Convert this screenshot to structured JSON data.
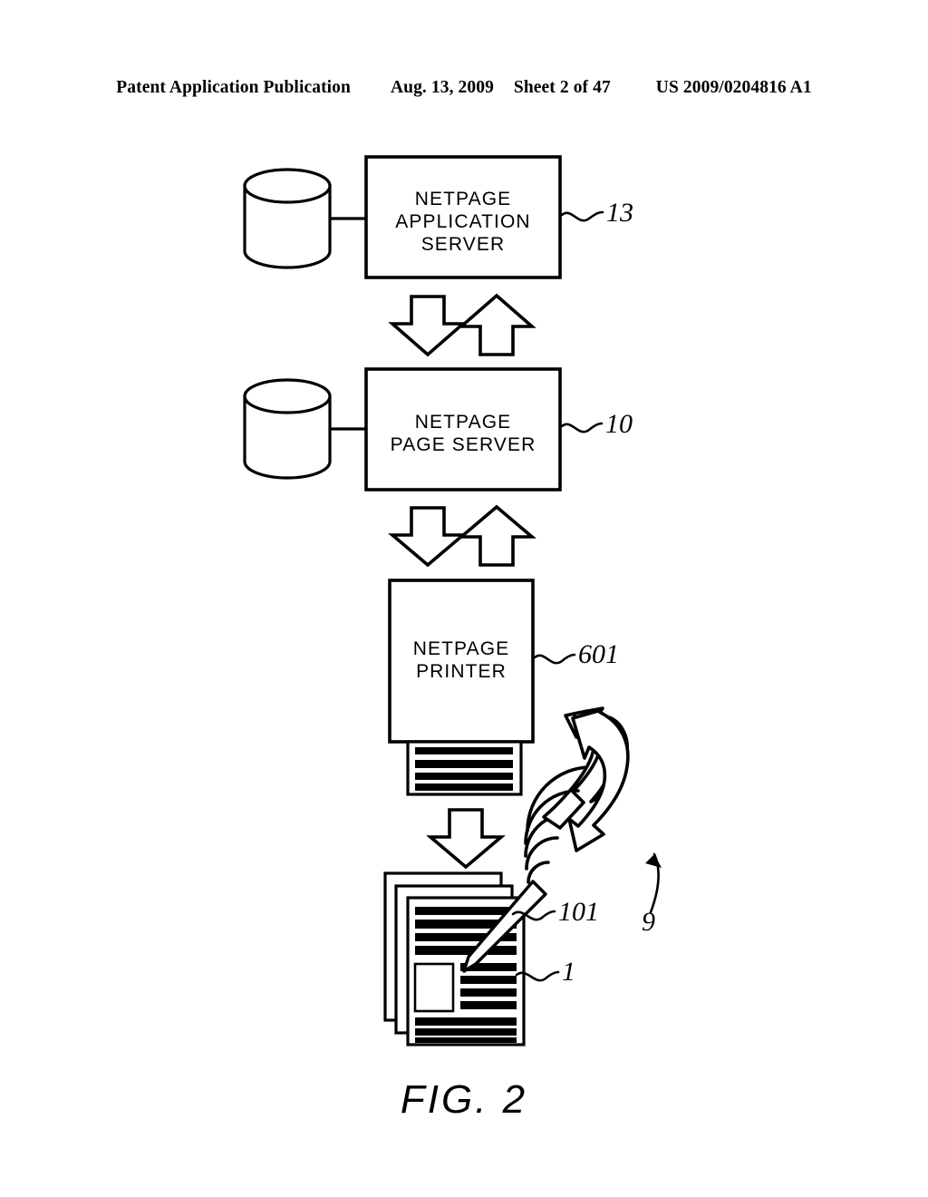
{
  "header": {
    "publication": "Patent Application Publication",
    "date": "Aug. 13, 2009",
    "sheet": "Sheet 2 of 47",
    "pub_number": "US 2009/0204816 A1"
  },
  "figure": {
    "caption": "FIG. 2",
    "blocks": [
      {
        "id": "netpage-application-server",
        "label": "NETPAGE\nAPPLICATION\nSERVER",
        "ref": "13"
      },
      {
        "id": "netpage-page-server",
        "label": "NETPAGE\nPAGE SERVER",
        "ref": "10"
      },
      {
        "id": "netpage-printer",
        "label": "NETPAGE\nPRINTER",
        "ref": "601"
      }
    ],
    "refs": {
      "application_server": "13",
      "page_server": "10",
      "printer": "601",
      "netpage_pen": "101",
      "netpage_document": "1",
      "pen_transmission": "9"
    },
    "icons": {
      "database_top": "database-cylinder-icon",
      "database_bottom": "database-cylinder-icon",
      "arrow_down_1": "block-arrow-down-icon",
      "arrow_up_1": "block-arrow-up-icon",
      "arrow_down_2": "block-arrow-down-icon",
      "arrow_up_2": "block-arrow-up-icon",
      "arrow_down_3": "block-arrow-down-icon",
      "curved_arrow": "curved-block-arrow-icon",
      "wireless_waves": "wireless-signal-icon",
      "pen": "stylus-pen-icon",
      "document_stack": "document-stack-icon",
      "printed_sheet": "printed-output-sheet-icon",
      "leader_9": "leader-arrow-icon"
    },
    "colors": {
      "ink": "#000000",
      "paper": "#ffffff"
    }
  }
}
